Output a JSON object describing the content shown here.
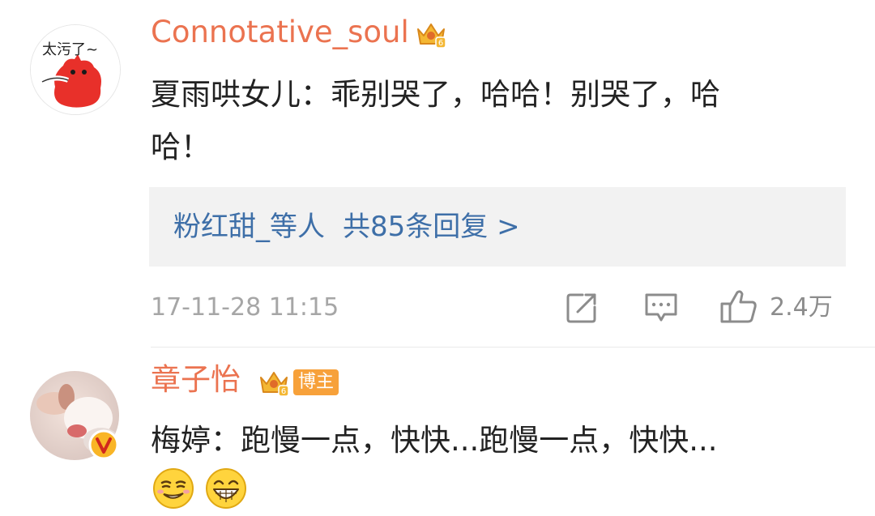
{
  "comments": [
    {
      "username": "Connotative_soul",
      "avatar_text": "太污了~",
      "text_line1": "夏雨哄女儿：乖别哭了，哈哈！别哭了，哈",
      "text_line2": "哈！",
      "replies": {
        "names": "粉红甜_等人",
        "count_text": "共85条回复 >"
      },
      "timestamp": "17-11-28 11:15",
      "likes": "2.4万"
    },
    {
      "username": "章子怡",
      "badge": "博主",
      "text_line1": "梅婷：跑慢一点，快快...跑慢一点，快快..."
    }
  ],
  "icons": {
    "crown": "vip-crown-icon",
    "share": "share-icon",
    "comment": "comment-icon",
    "like": "thumbs-up-icon",
    "verified": "verified-v-icon",
    "emoji_1": "smirk-emoji-icon",
    "emoji_2": "grin-emoji-icon"
  },
  "colors": {
    "username": "#eb7350",
    "link": "#3e6fa8",
    "meta": "#a6a6a6",
    "badge": "#f7a13a",
    "reply_bg": "#f2f2f2"
  }
}
